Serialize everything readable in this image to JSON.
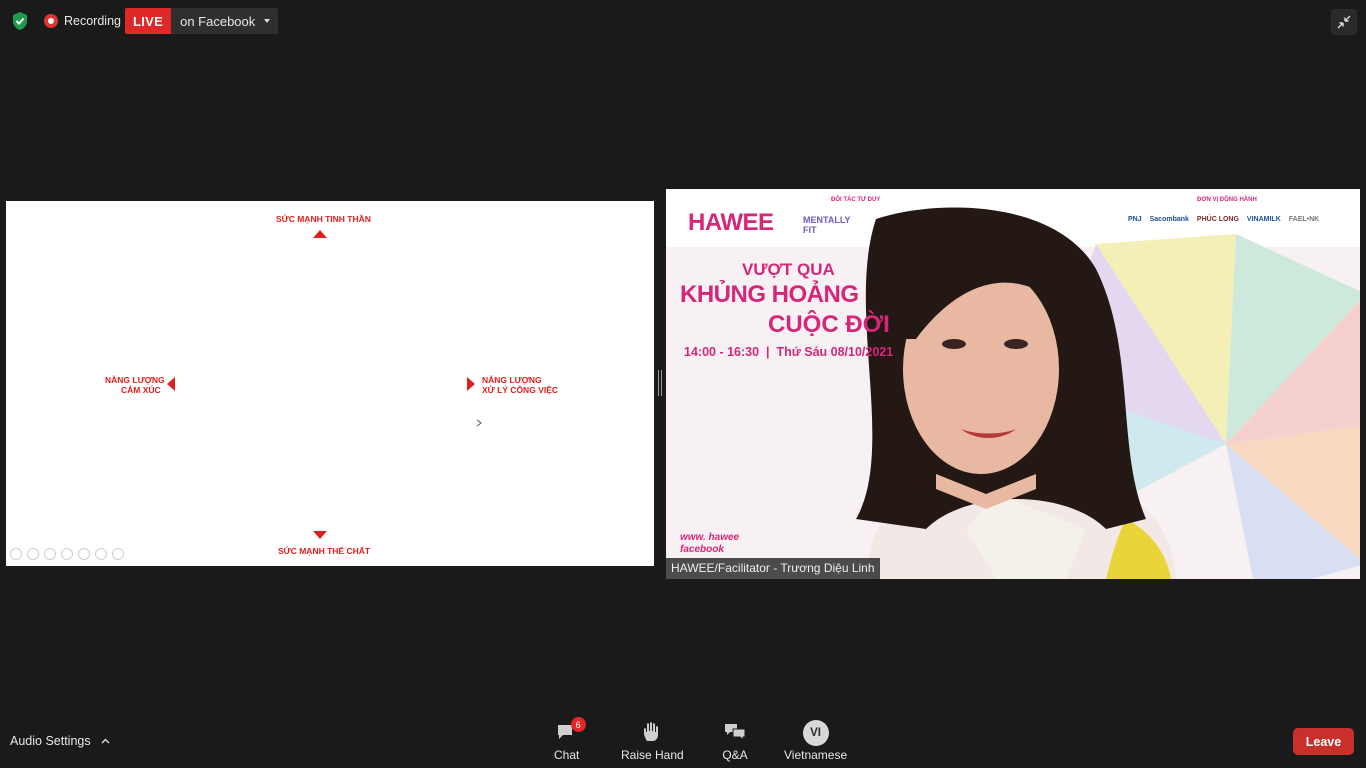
{
  "topbar": {
    "recording_label": "Recording",
    "live_label": "LIVE",
    "stream_target": "on Facebook"
  },
  "slide": {
    "top_label": "SỨC MẠNH TINH THẦN",
    "left_label_line1": "NĂNG LƯỢNG",
    "left_label_line2": "CẢM XÚC",
    "right_label_line1": "NĂNG LƯỢNG",
    "right_label_line2": "XỬ LÝ CÔNG VIỆC",
    "bottom_label": "SỨC MẠNH THỂ CHẤT",
    "accent_color": "#e0201b"
  },
  "video": {
    "participant_name": "HAWEE/Facilitator - Trương Diệu Linh",
    "banner": {
      "logo": "HAWEE",
      "partner_heading": "ĐỐI TÁC TƯ DUY",
      "partner_name": "MENTALLY FIT",
      "sponsor_heading": "ĐƠN VỊ ĐỒNG HÀNH",
      "sponsors": [
        "PNJ",
        "Sacombank",
        "PHÚC LONG",
        "VINAMILK",
        "FAEL•NK"
      ],
      "title_line1": "VƯỢT QUA",
      "title_line2": "KHỦNG HOẢNG",
      "title_line3": "CUỘC ĐỜI",
      "schedule": "14:00 - 16:30  |  Thứ Sáu 08/10/2021",
      "web": "www. hawee",
      "social": "facebook",
      "title_color": "#d6267a"
    }
  },
  "bottombar": {
    "audio_settings_label": "Audio Settings",
    "chat_label": "Chat",
    "chat_badge": "6",
    "raise_hand_label": "Raise Hand",
    "qa_label": "Q&A",
    "language_initials": "VI",
    "language_label": "Vietnamese",
    "leave_label": "Leave"
  }
}
